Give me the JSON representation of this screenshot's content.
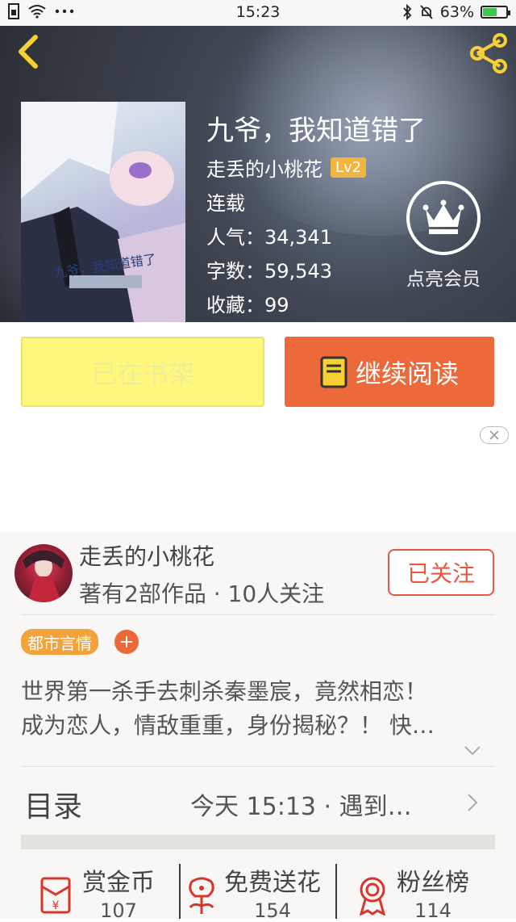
{
  "status_bar": {
    "time": "15:23",
    "battery": "63%",
    "battery_level": 0.63
  },
  "book": {
    "title": "九爷，我知道错了",
    "author": "走丢的小桃花",
    "author_level": "Lv2",
    "status": "连载",
    "popularity": "人气：34,341",
    "word_count": "字数：59,543",
    "favorites": "收藏：99",
    "cover_text": "九爷，我知道错了"
  },
  "vip": {
    "label": "点亮会员"
  },
  "actions": {
    "shelf_label": "已在书架",
    "read_label": "继续阅读"
  },
  "author_card": {
    "name": "走丢的小桃花",
    "stats": "著有2部作品 · 10人关注",
    "follow_label": "已关注"
  },
  "tags": [
    "都市言情"
  ],
  "tag_add": "+",
  "description": {
    "line1": "世界第一杀手去刺杀秦墨宸，竟然相恋！",
    "line2": "成为恋人，情敌重重，身份揭秘？！ 快…"
  },
  "toc": {
    "label": "目录",
    "latest": "今天 15:13 · 遇到…"
  },
  "stats": [
    {
      "label": "赏金币",
      "value": "107",
      "icon": "red-envelope-icon"
    },
    {
      "label": "免费送花",
      "value": "154",
      "icon": "flower-icon"
    },
    {
      "label": "粉丝榜",
      "value": "114",
      "icon": "medal-icon"
    }
  ],
  "colors": {
    "accent": "#ec6a3a",
    "shelf": "#fff77c",
    "tag": "#f4a33a",
    "follow": "#e45a42",
    "lv": "#f2b53d"
  }
}
